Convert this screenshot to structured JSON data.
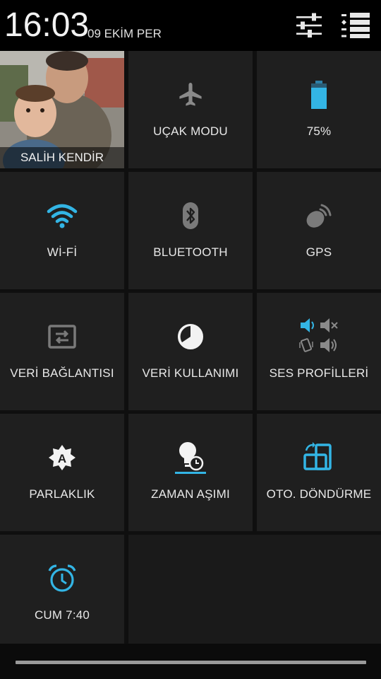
{
  "header": {
    "time": "16:03",
    "date": "09 EKİM PER",
    "settings_icon": "sliders-icon",
    "list_icon": "notification-list-icon"
  },
  "colors": {
    "accent": "#33b5e5",
    "inactive": "#8a8a8a",
    "tile": "#1f1f1f",
    "background": "#0f0f0f"
  },
  "tiles": {
    "user": {
      "label": "SALİH KENDİR",
      "icon": "user-photo"
    },
    "airplane": {
      "label": "UÇAK MODU",
      "icon": "airplane-icon"
    },
    "battery": {
      "label": "75%",
      "icon": "battery-icon",
      "level_percent": 75
    },
    "wifi": {
      "label": "Wİ-Fİ",
      "icon": "wifi-icon"
    },
    "bluetooth": {
      "label": "BLUETOOTH",
      "icon": "bluetooth-icon"
    },
    "gps": {
      "label": "GPS",
      "icon": "gps-icon"
    },
    "data_connection": {
      "label": "VERİ BAĞLANTISI",
      "icon": "data-transfer-icon"
    },
    "data_usage": {
      "label": "VERİ KULLANIMI",
      "icon": "data-usage-icon"
    },
    "sound_profiles": {
      "label": "SES PROFİLLERİ",
      "icon": "sound-profiles-icon"
    },
    "brightness": {
      "label": "PARLAKLIK",
      "icon": "brightness-auto-icon"
    },
    "timeout": {
      "label": "ZAMAN AŞIMI",
      "icon": "screen-timeout-icon"
    },
    "auto_rotate": {
      "label": "OTO. DÖNDÜRME",
      "icon": "auto-rotate-icon"
    },
    "alarm": {
      "label": "CUM 7:40",
      "icon": "alarm-clock-icon"
    }
  }
}
